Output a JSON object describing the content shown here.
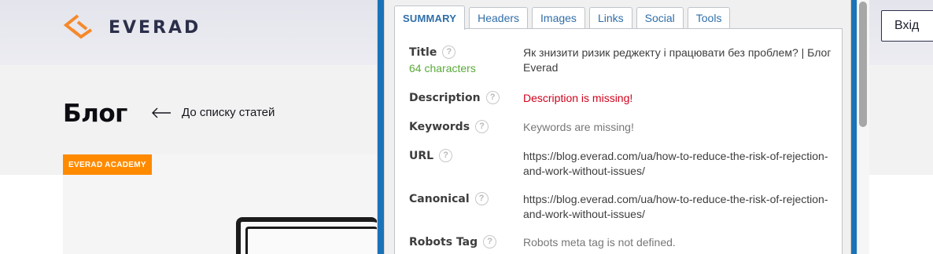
{
  "site": {
    "logo_text": "EVERAD",
    "login_label": "Вхід",
    "page_title": "Блог",
    "back_link": "До списку статей",
    "category_badge": "EVERAD ACADEMY",
    "accent_color": "#ff8a00"
  },
  "popup": {
    "tabs": [
      {
        "label": "SUMMARY",
        "active": true
      },
      {
        "label": "Headers",
        "active": false
      },
      {
        "label": "Images",
        "active": false
      },
      {
        "label": "Links",
        "active": false
      },
      {
        "label": "Social",
        "active": false
      },
      {
        "label": "Tools",
        "active": false
      }
    ],
    "help_glyph": "?",
    "rows": {
      "title": {
        "label": "Title",
        "sub": "64 characters",
        "value": "Як знизити ризик реджекту і працювати без проблем? | Блог Everad"
      },
      "description": {
        "label": "Description",
        "value": "Description is missing!"
      },
      "keywords": {
        "label": "Keywords",
        "value": "Keywords are missing!"
      },
      "url": {
        "label": "URL",
        "value": "https://blog.everad.com/ua/how-to-reduce-the-risk-of-rejection-and-work-without-issues/"
      },
      "canonical": {
        "label": "Canonical",
        "value": "https://blog.everad.com/ua/how-to-reduce-the-risk-of-rejection-and-work-without-issues/"
      },
      "robots": {
        "label": "Robots Tag",
        "value": "Robots meta tag is not defined."
      }
    },
    "colors": {
      "frame": "#1a73b7",
      "tab_text": "#2f6ea8",
      "missing": "#d0021b",
      "ok": "#5aaa3a"
    }
  }
}
